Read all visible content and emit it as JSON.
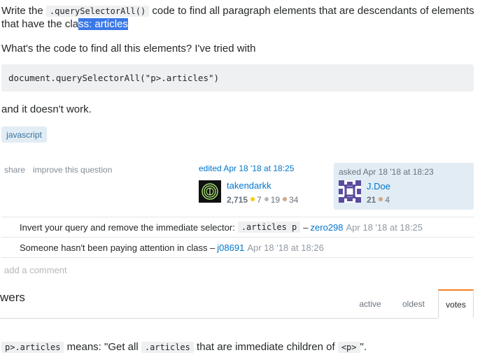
{
  "question": {
    "line1": {
      "pre": "Write the ",
      "code": ".querySelectorAll()",
      "post": " code to find all paragraph elements that are descendants of elements"
    },
    "line2": {
      "pre": "that have the cla",
      "selected": "ss: articles"
    },
    "line3": "What's the code to find all this elements? I've tried with",
    "code_block": "document.querySelectorAll(\"p>.articles\")",
    "line4": "and it doesn't work.",
    "tags": [
      "javascript"
    ]
  },
  "post_menu": {
    "share": "share",
    "improve": "improve this question"
  },
  "edited": {
    "action": "edited Apr 18 '18 at 18:25",
    "user": "takendarkk",
    "rep": "2,715",
    "gold": "7",
    "silver": "19",
    "bronze": "34"
  },
  "asked": {
    "action": "asked Apr 18 '18 at 18:23",
    "user": "J.Doe",
    "rep": "21",
    "bronze": "4"
  },
  "comments": [
    {
      "text": "Invert your query and remove the immediate selector:",
      "code": ".articles p",
      "sep": "–",
      "user": "zero298",
      "date": "Apr 18 '18 at 18:25"
    },
    {
      "text": "Someone hasn't been paying attention in class –",
      "user": "j08691",
      "date": "Apr 18 '18 at 18:26"
    }
  ],
  "add_comment": "add a comment",
  "answers_header": "wers",
  "sort_tabs": [
    "active",
    "oldest",
    "votes"
  ],
  "answer": {
    "code1": "p>.articles",
    "text1": " means: \"Get all ",
    "code2": ".articles",
    "text2": " that are immediate children of ",
    "code3": "<p>",
    "text3": "\"."
  },
  "colors": {
    "link": "#0077cc",
    "selection": "#3b78e7",
    "owner_bg": "#e1ecf4",
    "gold": "#ffcc01",
    "silver": "#b4b8bc",
    "bronze": "#d1a684",
    "tab_accent": "#f48024"
  }
}
